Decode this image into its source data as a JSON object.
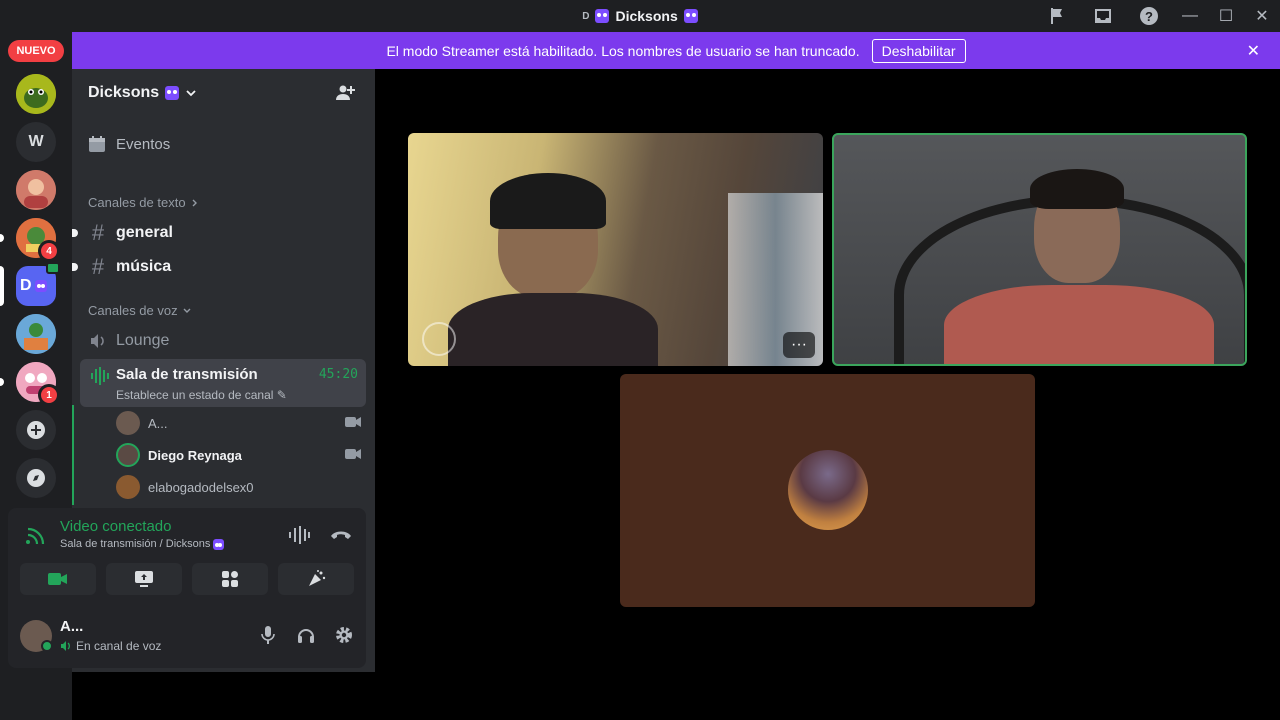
{
  "window": {
    "title_prefix": "D",
    "title": "Dicksons",
    "min": "—",
    "max": "☐",
    "close": "✕"
  },
  "banner": {
    "message": "El modo Streamer está habilitado. Los nombres de usuario se han truncado.",
    "button": "Deshabilitar",
    "close": "✕"
  },
  "rail": {
    "new_badge": "NUEVO",
    "servers": [
      {
        "label": "",
        "badge": ""
      },
      {
        "label": "W",
        "badge": ""
      },
      {
        "label": "",
        "badge": ""
      },
      {
        "label": "",
        "badge": "4"
      },
      {
        "label": "D",
        "badge": ""
      },
      {
        "label": "",
        "badge": ""
      },
      {
        "label": "",
        "badge": "1"
      }
    ]
  },
  "sidebar": {
    "server_name": "Dicksons",
    "events": "Eventos",
    "text_category": "Canales de texto",
    "text_channels": [
      "general",
      "música"
    ],
    "voice_category": "Canales de voz",
    "voice_channels": {
      "lounge": "Lounge",
      "active": "Sala de transmisión",
      "active_status": "Establece un estado de canal",
      "timer": "45:20"
    },
    "voice_users": [
      "A...",
      "Diego Reynaga",
      "elabogadodelsex0"
    ]
  },
  "voice_panel": {
    "status": "Video conectado",
    "location": "Sala de transmisión / Dicksons"
  },
  "user": {
    "name": "A...",
    "status": "En canal de voz"
  },
  "video": {
    "tile_more": "···"
  }
}
